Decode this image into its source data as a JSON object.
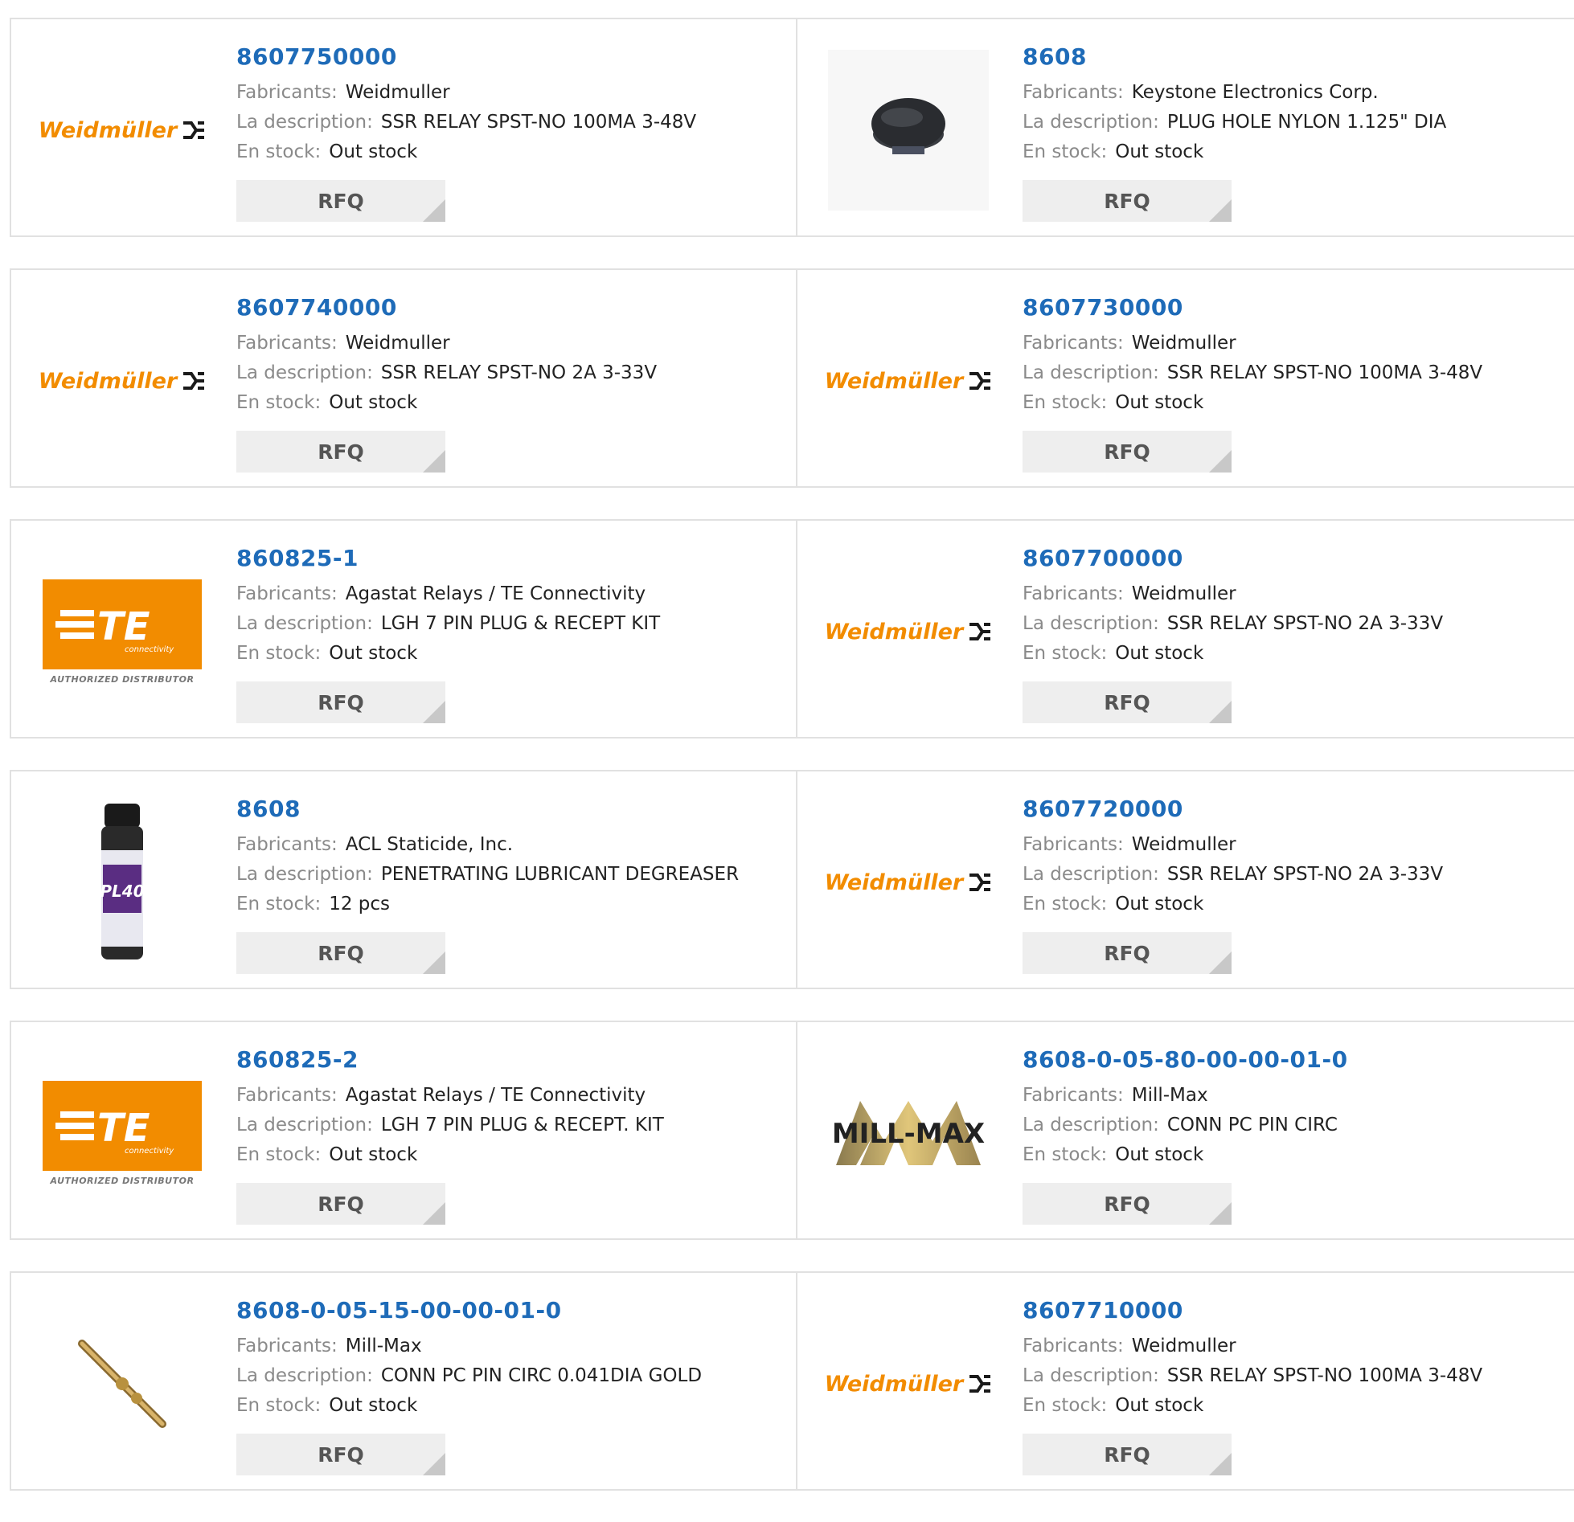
{
  "labels": {
    "manufacturer": "Fabricants:",
    "description": "La description:",
    "stock": "En stock:",
    "rfq": "RFQ"
  },
  "te_logo": {
    "caption": "AUTHORIZED DISTRIBUTOR",
    "letters": "TE",
    "sub": "connectivity"
  },
  "weidmuller_logo": {
    "text": "Weidmüller"
  },
  "millmax_logo": {
    "text": "MILL-MAX"
  },
  "products": [
    {
      "part": "8607750000",
      "manufacturer": "Weidmuller",
      "description": "SSR RELAY SPST-NO 100MA 3-48V",
      "stock": "Out stock",
      "logo": "weidmuller-logo"
    },
    {
      "part": "8608",
      "manufacturer": "Keystone Electronics Corp.",
      "description": "PLUG HOLE NYLON 1.125\" DIA",
      "stock": "Out stock",
      "logo": "plug-hole-image"
    },
    {
      "part": "8607740000",
      "manufacturer": "Weidmuller",
      "description": "SSR RELAY SPST-NO 2A 3-33V",
      "stock": "Out stock",
      "logo": "weidmuller-logo"
    },
    {
      "part": "8607730000",
      "manufacturer": "Weidmuller",
      "description": "SSR RELAY SPST-NO 100MA 3-48V",
      "stock": "Out stock",
      "logo": "weidmuller-logo"
    },
    {
      "part": "860825-1",
      "manufacturer": "Agastat Relays / TE Connectivity",
      "description": "LGH 7 PIN PLUG & RECEPT KIT",
      "stock": "Out stock",
      "logo": "te-connectivity-logo"
    },
    {
      "part": "8607700000",
      "manufacturer": "Weidmuller",
      "description": "SSR RELAY SPST-NO 2A 3-33V",
      "stock": "Out stock",
      "logo": "weidmuller-logo"
    },
    {
      "part": "8608",
      "manufacturer": "ACL Staticide, Inc.",
      "description": "PENETRATING LUBRICANT DEGREASER",
      "stock": "12 pcs",
      "logo": "spray-can-image"
    },
    {
      "part": "8607720000",
      "manufacturer": "Weidmuller",
      "description": "SSR RELAY SPST-NO 2A 3-33V",
      "stock": "Out stock",
      "logo": "weidmuller-logo"
    },
    {
      "part": "860825-2",
      "manufacturer": "Agastat Relays / TE Connectivity",
      "description": "LGH 7 PIN PLUG & RECEPT. KIT",
      "stock": "Out stock",
      "logo": "te-connectivity-logo"
    },
    {
      "part": "8608-0-05-80-00-00-01-0",
      "manufacturer": "Mill-Max",
      "description": "CONN PC PIN CIRC",
      "stock": "Out stock",
      "logo": "mill-max-logo"
    },
    {
      "part": "8608-0-05-15-00-00-01-0",
      "manufacturer": "Mill-Max",
      "description": "CONN PC PIN CIRC 0.041DIA GOLD",
      "stock": "Out stock",
      "logo": "pin-image"
    },
    {
      "part": "8607710000",
      "manufacturer": "Weidmuller",
      "description": "SSR RELAY SPST-NO 100MA 3-48V",
      "stock": "Out stock",
      "logo": "weidmuller-logo"
    }
  ],
  "colors": {
    "link": "#1e6bb8",
    "label": "#8a8a8a",
    "border": "#e1e1e1",
    "button": "#eeeeee",
    "brand_orange": "#f28c00"
  }
}
